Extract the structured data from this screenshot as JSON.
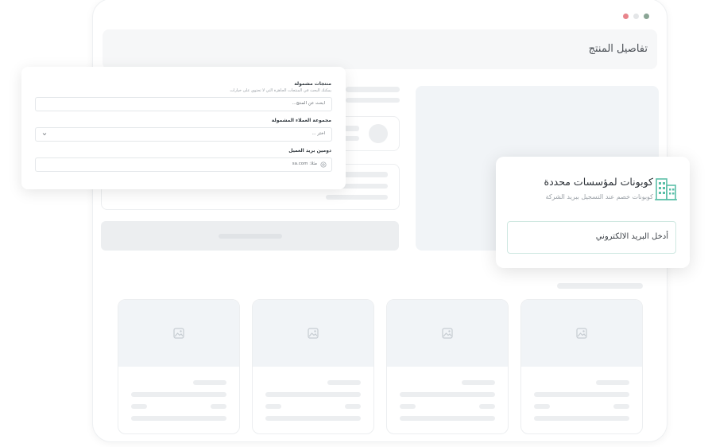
{
  "window": {
    "dot_colors": [
      "#e8848b",
      "#e4e6e8",
      "#8aa595"
    ]
  },
  "header": {
    "title": "تفاصيل المنتج"
  },
  "form": {
    "products_label": "منتجات مشمولة",
    "products_hint": "يمكنك البحث في المنتجات الجاهزة التي لا تحتوي على خيارات",
    "products_placeholder": "ابحث عن المنتج...",
    "group_label": "مجموعة العملاء المشمولة",
    "group_select": "اختر ...",
    "email_label": "دومين بريد العميل",
    "email_value": "مثلا: sa.com"
  },
  "coupon": {
    "title": "كوبونات لمؤسسات محددة",
    "subtitle": "كوبونات خصم عند التسجيل ببريد الشركة",
    "input_value": "أدخل البريد الالكتروني",
    "accent": "#5bbfa8"
  },
  "products": {
    "count": 4
  }
}
